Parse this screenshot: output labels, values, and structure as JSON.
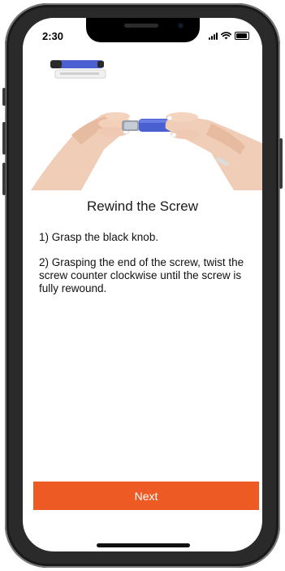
{
  "status_bar": {
    "time": "2:30"
  },
  "content": {
    "title": "Rewind the Screw",
    "steps": [
      "1) Grasp the black knob.",
      "2) Grasping the end of the screw, twist the screw counter clockwise until the screw is fully rewound."
    ],
    "image": {
      "semantic": "hands-twisting-blue-injection-pen-photo",
      "pen_color": "#4a5fd0"
    }
  },
  "actions": {
    "next_label": "Next"
  },
  "colors": {
    "accent": "#ee5a24",
    "background": "#ffffff",
    "text": "#111111"
  }
}
